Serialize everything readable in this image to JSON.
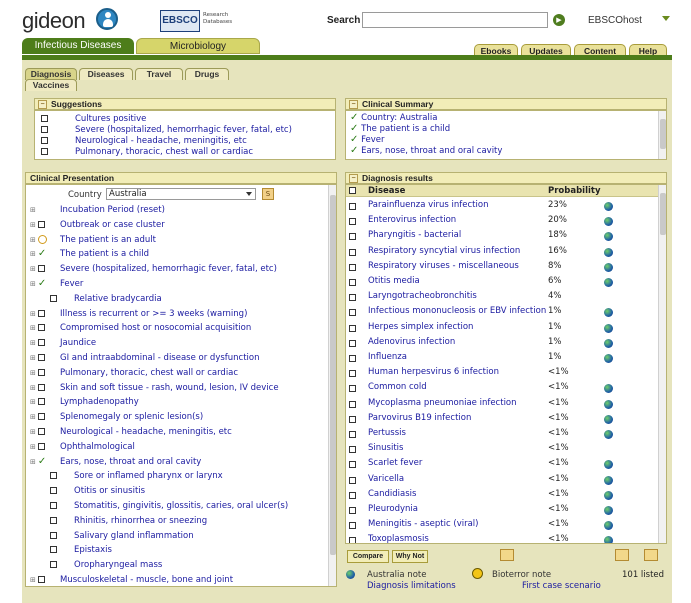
{
  "header": {
    "logo_text": "gideon",
    "ebsco_text": "EBSCO",
    "ebsco_sub1": "Research",
    "ebsco_sub2": "Databases",
    "search_label": "Search",
    "search_value": "",
    "ebscohost_label": "EBSCOhost",
    "main_tabs": [
      "Infectious Diseases",
      "Microbiology"
    ],
    "nav_buttons": [
      "Ebooks",
      "Updates",
      "Content",
      "Help"
    ]
  },
  "subtabs": [
    "Diagnosis",
    "Diseases",
    "Travel",
    "Drugs",
    "Vaccines"
  ],
  "suggestions": {
    "title": "Suggestions",
    "items": [
      "Cultures positive",
      "Severe (hospitalized, hemorrhagic fever, fatal, etc)",
      "Neurological - headache, meningitis, etc",
      "Pulmonary, thoracic, chest wall or cardiac"
    ]
  },
  "clinical_summary": {
    "title": "Clinical Summary",
    "items": [
      "Country: Australia",
      "The patient is a child",
      "Fever",
      "Ears, nose, throat and oral cavity"
    ]
  },
  "clinical_presentation": {
    "title": "Clinical Presentation",
    "country_label": "Country",
    "country_value": "Australia",
    "items": [
      {
        "label": "Incubation Period (reset)",
        "state": "none",
        "indent": 0
      },
      {
        "label": "Outbreak or case cluster",
        "state": "box",
        "indent": 0
      },
      {
        "label": "The patient is an adult",
        "state": "no",
        "indent": 0
      },
      {
        "label": "The patient is a child",
        "state": "check",
        "indent": 0
      },
      {
        "label": "Severe (hospitalized, hemorrhagic fever, fatal, etc)",
        "state": "box",
        "indent": 0
      },
      {
        "label": "Fever",
        "state": "check",
        "indent": 0
      },
      {
        "label": "Relative bradycardia",
        "state": "box",
        "indent": 1
      },
      {
        "label": "Illness is recurrent or >= 3 weeks (warning)",
        "state": "box",
        "indent": 0
      },
      {
        "label": "Compromised host or nosocomial acquisition",
        "state": "box",
        "indent": 0
      },
      {
        "label": "Jaundice",
        "state": "box",
        "indent": 0
      },
      {
        "label": "GI and intraabdominal - disease or dysfunction",
        "state": "box",
        "indent": 0
      },
      {
        "label": "Pulmonary, thoracic, chest wall or cardiac",
        "state": "box",
        "indent": 0
      },
      {
        "label": "Skin and soft tissue - rash, wound, lesion, IV device",
        "state": "box",
        "indent": 0
      },
      {
        "label": "Lymphadenopathy",
        "state": "box",
        "indent": 0
      },
      {
        "label": "Splenomegaly or splenic lesion(s)",
        "state": "box",
        "indent": 0
      },
      {
        "label": "Neurological - headache, meningitis, etc",
        "state": "box",
        "indent": 0
      },
      {
        "label": "Ophthalmological",
        "state": "box",
        "indent": 0
      },
      {
        "label": "Ears, nose, throat and oral cavity",
        "state": "check",
        "indent": 0
      },
      {
        "label": "Sore or inflamed pharynx or larynx",
        "state": "box",
        "indent": 1
      },
      {
        "label": "Otitis or sinusitis",
        "state": "box",
        "indent": 1
      },
      {
        "label": "Stomatitis, gingivitis, glossitis, caries, oral ulcer(s)",
        "state": "box",
        "indent": 1
      },
      {
        "label": "Rhinitis, rhinorrhea or sneezing",
        "state": "box",
        "indent": 1
      },
      {
        "label": "Salivary gland inflammation",
        "state": "box",
        "indent": 1
      },
      {
        "label": "Epistaxis",
        "state": "box",
        "indent": 1
      },
      {
        "label": "Oropharyngeal mass",
        "state": "box",
        "indent": 1
      },
      {
        "label": "Musculoskeletal - muscle, bone and joint",
        "state": "box",
        "indent": 0
      }
    ]
  },
  "diagnosis_results": {
    "title": "Diagnosis results",
    "col_disease": "Disease",
    "col_probability": "Probability",
    "rows": [
      {
        "disease": "Parainfluenza virus infection",
        "prob": "23%",
        "globe": true
      },
      {
        "disease": "Enterovirus infection",
        "prob": "20%",
        "globe": true
      },
      {
        "disease": "Pharyngitis - bacterial",
        "prob": "18%",
        "globe": true
      },
      {
        "disease": "Respiratory syncytial virus infection",
        "prob": "16%",
        "globe": true
      },
      {
        "disease": "Respiratory viruses - miscellaneous",
        "prob": "8%",
        "globe": true
      },
      {
        "disease": "Otitis media",
        "prob": "6%",
        "globe": true
      },
      {
        "disease": "Laryngotracheobronchitis",
        "prob": "4%",
        "globe": false
      },
      {
        "disease": "Infectious mononucleosis or EBV infection",
        "prob": "1%",
        "globe": true
      },
      {
        "disease": "Herpes simplex infection",
        "prob": "1%",
        "globe": true
      },
      {
        "disease": "Adenovirus infection",
        "prob": "1%",
        "globe": true
      },
      {
        "disease": "Influenza",
        "prob": "1%",
        "globe": true
      },
      {
        "disease": "Human herpesvirus 6 infection",
        "prob": "<1%",
        "globe": false
      },
      {
        "disease": "Common cold",
        "prob": "<1%",
        "globe": true
      },
      {
        "disease": "Mycoplasma pneumoniae infection",
        "prob": "<1%",
        "globe": true
      },
      {
        "disease": "Parvovirus B19 infection",
        "prob": "<1%",
        "globe": true
      },
      {
        "disease": "Pertussis",
        "prob": "<1%",
        "globe": true
      },
      {
        "disease": "Sinusitis",
        "prob": "<1%",
        "globe": false
      },
      {
        "disease": "Scarlet fever",
        "prob": "<1%",
        "globe": true
      },
      {
        "disease": "Varicella",
        "prob": "<1%",
        "globe": true
      },
      {
        "disease": "Candidiasis",
        "prob": "<1%",
        "globe": true
      },
      {
        "disease": "Pleurodynia",
        "prob": "<1%",
        "globe": true
      },
      {
        "disease": "Meningitis - aseptic (viral)",
        "prob": "<1%",
        "globe": true
      },
      {
        "disease": "Toxoplasmosis",
        "prob": "<1%",
        "globe": true
      }
    ],
    "compare_label": "Compare",
    "why_not_label": "Why Not",
    "australia_note": "Australia note",
    "diagnosis_limitations": "Diagnosis limitations",
    "bioterror_note": "Bioterror note",
    "first_case": "First case scenario",
    "listed": "101 listed"
  }
}
